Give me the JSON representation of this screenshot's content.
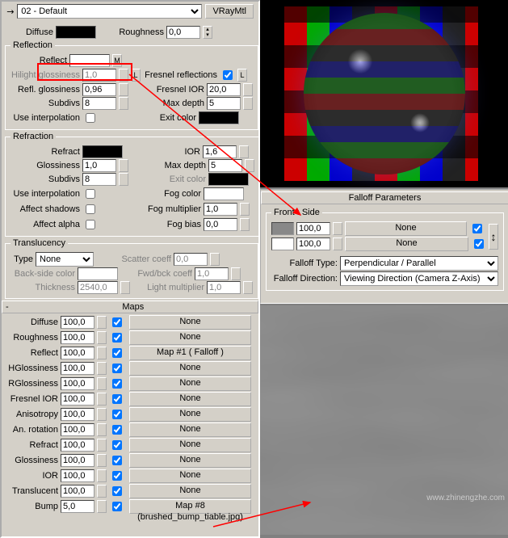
{
  "topbar": {
    "dropper": "↘",
    "material": "02 - Default",
    "type_btn": "VRayMtl"
  },
  "basic": {
    "diffuse_label": "Diffuse",
    "roughness_label": "Roughness",
    "roughness_val": "0,0"
  },
  "reflection": {
    "title": "Reflection",
    "reflect": "Reflect",
    "m_btn": "M",
    "hilight": "Hilight glossiness",
    "hilight_val": "1,0",
    "L": "L",
    "refl_gloss": "Refl. glossiness",
    "refl_gloss_val": "0,96",
    "subdivs": "Subdivs",
    "subdivs_val": "8",
    "use_interp": "Use interpolation",
    "fresnel": "Fresnel reflections",
    "fresnel_chk": "L",
    "fresnel_ior": "Fresnel IOR",
    "fresnel_ior_val": "20,0",
    "max_depth": "Max depth",
    "max_depth_val": "5",
    "exit": "Exit color"
  },
  "refraction": {
    "title": "Refraction",
    "refract": "Refract",
    "gloss": "Glossiness",
    "gloss_val": "1,0",
    "subdivs": "Subdivs",
    "subdivs_val": "8",
    "use_interp": "Use interpolation",
    "affect_shadows": "Affect shadows",
    "affect_alpha": "Affect alpha",
    "ior": "IOR",
    "ior_val": "1,6",
    "max_depth": "Max depth",
    "max_depth_val": "5",
    "exit": "Exit color",
    "fog_color": "Fog color",
    "fog_mult": "Fog multiplier",
    "fog_mult_val": "1,0",
    "fog_bias": "Fog bias",
    "fog_bias_val": "0,0"
  },
  "translucency": {
    "title": "Translucency",
    "type": "Type",
    "type_val": "None",
    "back": "Back-side color",
    "thickness": "Thickness",
    "thickness_val": "2540,0",
    "scatter": "Scatter coeff",
    "scatter_val": "0,0",
    "fwd": "Fwd/bck coeff",
    "fwd_val": "1,0",
    "light": "Light multiplier",
    "light_val": "1,0"
  },
  "maps": {
    "title": "Maps",
    "none": "None",
    "rows": [
      {
        "label": "Diffuse",
        "val": "100,0",
        "chk": true,
        "slot": "None"
      },
      {
        "label": "Roughness",
        "val": "100,0",
        "chk": true,
        "slot": "None"
      },
      {
        "label": "Reflect",
        "val": "100,0",
        "chk": true,
        "slot": "Map #1  ( Falloff )"
      },
      {
        "label": "HGlossiness",
        "val": "100,0",
        "chk": true,
        "slot": "None"
      },
      {
        "label": "RGlossiness",
        "val": "100,0",
        "chk": true,
        "slot": "None"
      },
      {
        "label": "Fresnel IOR",
        "val": "100,0",
        "chk": true,
        "slot": "None"
      },
      {
        "label": "Anisotropy",
        "val": "100,0",
        "chk": true,
        "slot": "None"
      },
      {
        "label": "An. rotation",
        "val": "100,0",
        "chk": true,
        "slot": "None"
      },
      {
        "label": "Refract",
        "val": "100,0",
        "chk": true,
        "slot": "None"
      },
      {
        "label": "Glossiness",
        "val": "100,0",
        "chk": true,
        "slot": "None"
      },
      {
        "label": "IOR",
        "val": "100,0",
        "chk": true,
        "slot": "None"
      },
      {
        "label": "Translucent",
        "val": "100,0",
        "chk": true,
        "slot": "None"
      },
      {
        "label": "Bump",
        "val": "5,0",
        "chk": true,
        "slot": "Map #8 (brushed_bump_tiable.jpg)"
      }
    ]
  },
  "falloff": {
    "header": "Falloff Parameters",
    "group": "Front : Side",
    "v1": "100,0",
    "v2": "100,0",
    "none": "None",
    "type_lbl": "Falloff Type:",
    "type_val": "Perpendicular / Parallel",
    "dir_lbl": "Falloff Direction:",
    "dir_val": "Viewing Direction (Camera Z-Axis)",
    "swap": "↕"
  },
  "watermark": "www.zhinengzhe.com",
  "minus": "-",
  "plus": "+"
}
